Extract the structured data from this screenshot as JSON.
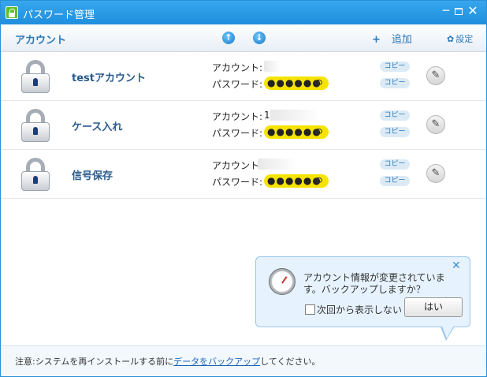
{
  "window": {
    "title": "パスワード管理",
    "min_glyph": "─",
    "close_glyph": "✕"
  },
  "toolbar": {
    "column_label": "アカウント",
    "sort_up_glyph": "↑",
    "sort_down_glyph": "↓",
    "add_glyph": "+",
    "add_label": "追加",
    "settings_glyph": "✿",
    "settings_label": "設定"
  },
  "labels": {
    "account": "アカウント:",
    "password": "パスワード:",
    "copy": "コピー",
    "edit_glyph": "✎"
  },
  "entries": [
    {
      "name": "testアカウント",
      "account_visible": "",
      "password_mask": "●●●●●●"
    },
    {
      "name": "ケース入れ",
      "account_visible": "1",
      "password_mask": "●●●●●●"
    },
    {
      "name": "信号保存",
      "account_visible": "",
      "password_mask": "●●●●●●"
    }
  ],
  "popup": {
    "message": "アカウント情報が変更されています。バックアップしますか？",
    "checkbox_label": "次回から表示しない",
    "checkbox_checked": false,
    "yes_label": "はい",
    "close_glyph": "✕"
  },
  "footer": {
    "prefix": "注意:システムを再インストールする前に",
    "link": "データをバックアップ",
    "suffix": "してください。"
  },
  "icons": {
    "app": "app-lock-icon",
    "entry": "padlock-icon",
    "gauge": "gauge-icon",
    "edit": "pencil-icon",
    "eye": "eye-icon"
  }
}
